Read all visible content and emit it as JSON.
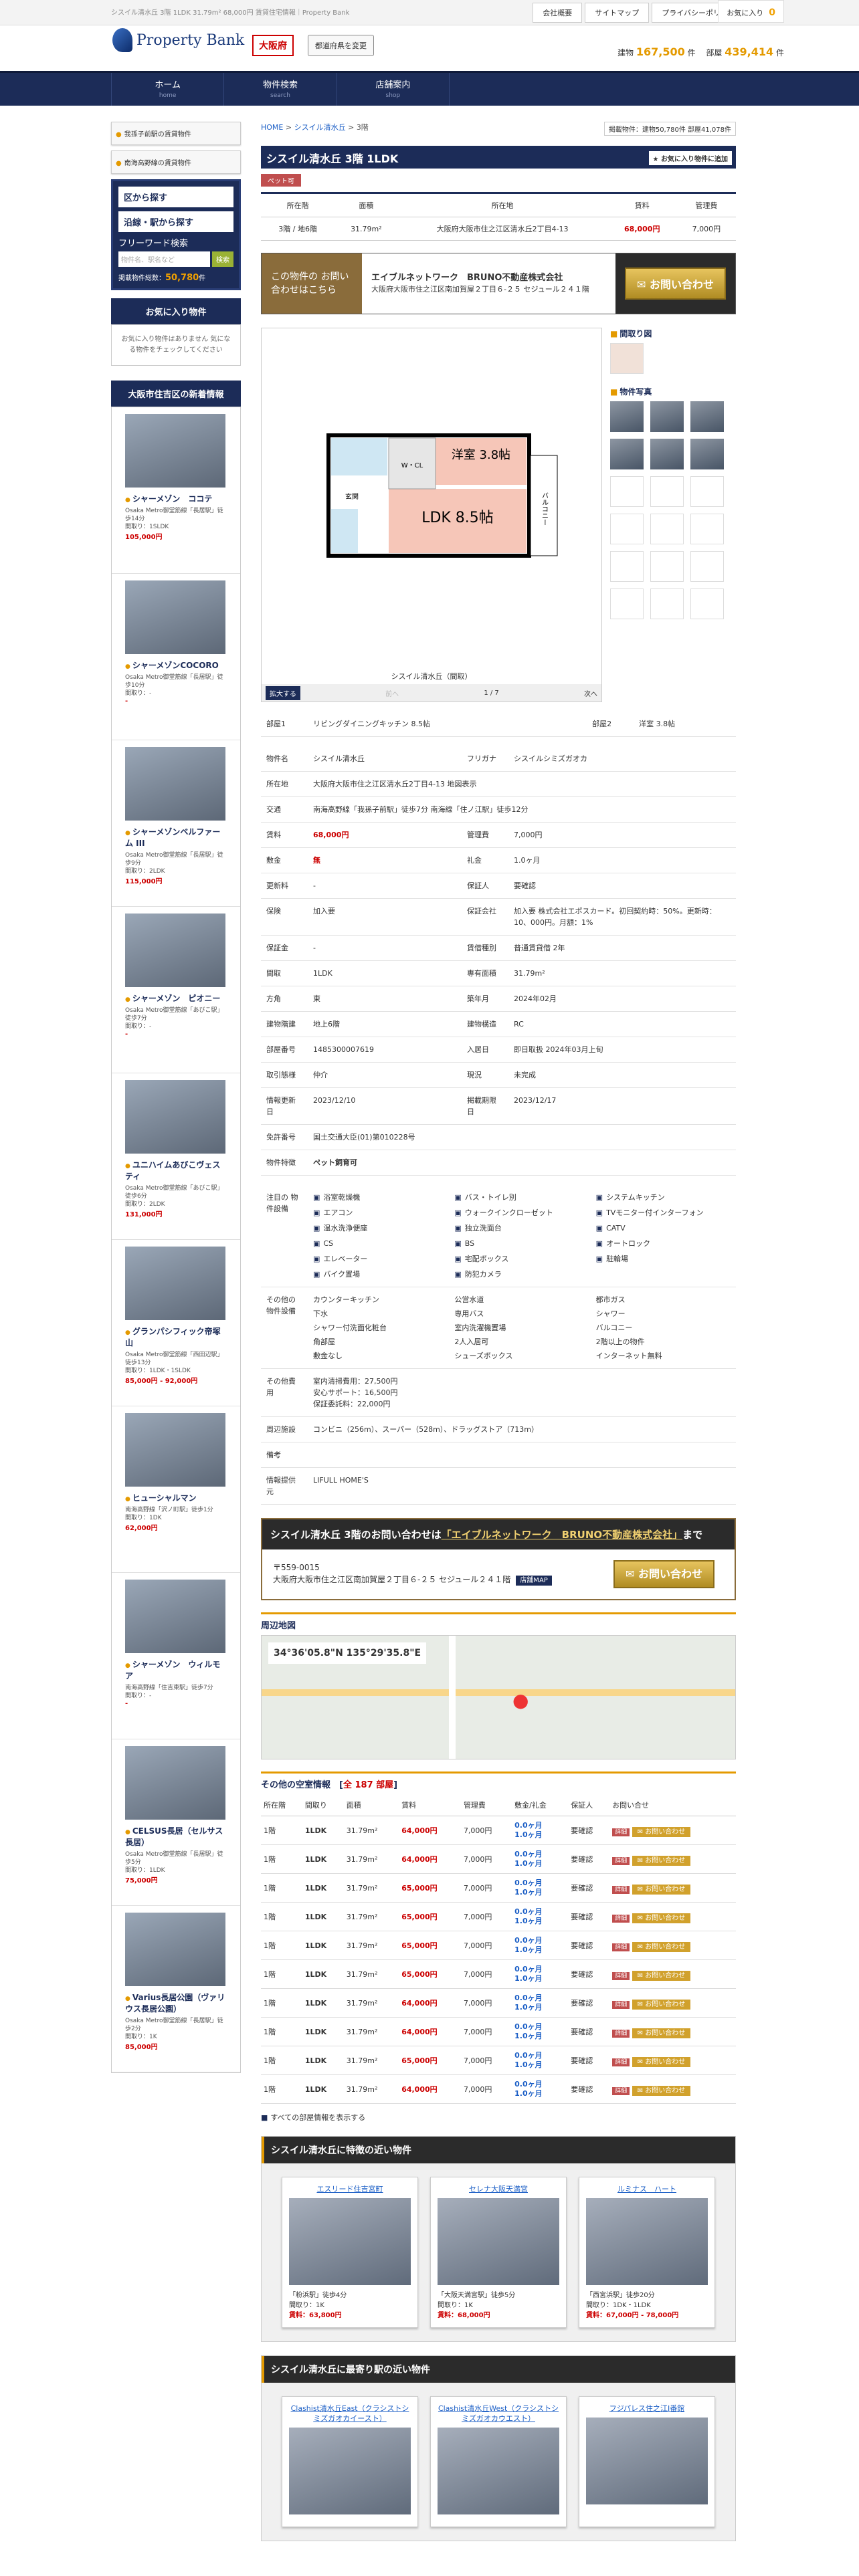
{
  "top": {
    "tagline": "シスイル清水丘 3階 1LDK 31.79m² 68,000円 賃貸住宅情報｜Property Bank",
    "links": [
      "会社概要",
      "サイトマップ",
      "プライバシーポリシー"
    ],
    "fav_label": "お気に入り",
    "fav_count": "0"
  },
  "header": {
    "logo": "Property Bank",
    "pref": "大阪府",
    "pref_change": "都道府県を変更",
    "count_label1": "建物",
    "count1": "167,500",
    "unit1": "件",
    "count_label2": "部屋",
    "count2": "439,414",
    "unit2": "件"
  },
  "nav": [
    {
      "label": "ホーム",
      "sub": "home"
    },
    {
      "label": "物件検索",
      "sub": "search"
    },
    {
      "label": "店舗案内",
      "sub": "shop"
    }
  ],
  "sidebar": {
    "btn1": "我孫子前駅の賃貸物件",
    "btn2": "南海高野線の賃貸物件",
    "search_area": "区から探す",
    "search_line": "沿線・駅から探す",
    "free_label": "フリーワード検索",
    "free_placeholder": "物件名、駅名など",
    "free_btn": "検索",
    "total_label": "掲載物件総数：",
    "total": "50,780",
    "total_unit": "件",
    "fav_head": "お気に入り物件",
    "fav_empty": "お気に入り物件はありません 気になる物件をチェックしてください",
    "new_head": "大阪市住吉区の新着情報",
    "new_items": [
      {
        "name": "シャーメゾン　ココテ",
        "l1": "Osaka Metro御堂筋線「長居駅」徒歩14分",
        "l2": "間取り：1SLDK",
        "price": "105,000円"
      },
      {
        "name": "シャーメゾンCOCORO",
        "l1": "Osaka Metro御堂筋線「長居駅」徒歩10分",
        "l2": "間取り：-",
        "price": "-"
      },
      {
        "name": "シャーメゾンベルファーム III",
        "l1": "Osaka Metro御堂筋線「長居駅」徒歩9分",
        "l2": "間取り：2LDK",
        "price": "115,000円"
      },
      {
        "name": "シャーメゾン　ピオニー",
        "l1": "Osaka Metro御堂筋線「あびこ駅」徒歩7分",
        "l2": "間取り：-",
        "price": "-"
      },
      {
        "name": "ユニハイムあびこヴェスティ",
        "l1": "Osaka Metro御堂筋線「あびこ駅」徒歩6分",
        "l2": "間取り：2LDK",
        "price": "131,000円"
      },
      {
        "name": "グランパシフィック帝塚山",
        "l1": "Osaka Metro御堂筋線「西田辺駅」徒歩13分",
        "l2": "間取り：1LDK・1SLDK",
        "price": "85,000円 - 92,000円"
      },
      {
        "name": "ヒューシャルマン",
        "l1": "南海高野線「沢ノ町駅」徒歩1分",
        "l2": "間取り：1DK",
        "price": "62,000円"
      },
      {
        "name": "シャーメゾン　ウィルモア",
        "l1": "南海高野線「住吉東駅」徒歩7分",
        "l2": "間取り：-",
        "price": "-"
      },
      {
        "name": "CELSUS長居（セルサス長居）",
        "l1": "Osaka Metro御堂筋線「長居駅」徒歩5分",
        "l2": "間取り：1LDK",
        "price": "75,000円"
      },
      {
        "name": "Varius長居公園（ヴァリウス長居公園）",
        "l1": "Osaka Metro御堂筋線「長居駅」徒歩2分",
        "l2": "間取り：1K",
        "price": "85,000円"
      }
    ]
  },
  "main": {
    "crumb": [
      "HOME",
      "シスイル清水丘",
      "3階"
    ],
    "crumb_counts": "掲載物件：建物50,780件 部屋41,078件",
    "title": "シスイル清水丘 3階 1LDK",
    "fav_btn": "お気に入り物件に追加",
    "pet": "ペット可",
    "summary": {
      "headers": [
        "所在階",
        "面積",
        "所在地",
        "賃料",
        "管理費"
      ],
      "row": [
        "3階 / 地6階",
        "31.79m²",
        "大阪府大阪市住之江区清水丘2丁目4-13",
        "68,000円",
        "7,000円"
      ]
    },
    "contact": {
      "lead": "この物件の お問い合わせはこちら",
      "company": "エイブルネットワーク　BRUNO不動産株式会社",
      "address": "大阪府大阪市住之江区南加賀屋２丁目６-２５ セジュール２４１階",
      "btn": "お問い合わせ"
    },
    "plan": {
      "room1": "洋室 3.8帖",
      "room2": "LDK 8.5帖",
      "wcl": "W・CL",
      "bal": "バルコニー",
      "ent": "玄関"
    },
    "caption": "シスイル清水丘（間取）",
    "zoom": "拡大する",
    "prev": "前へ",
    "pager": "1 / 7",
    "next": "次へ",
    "thumb_plan": "間取り図",
    "thumb_photo": "物件写真",
    "rooms": [
      [
        "部屋1",
        "リビングダイニングキッチン 8.5帖",
        "部屋2",
        "洋室 3.8帖"
      ]
    ],
    "details": [
      [
        "物件名",
        "シスイル清水丘",
        "フリガナ",
        "シスイルシミズガオカ"
      ],
      [
        "所在地",
        "大阪府大阪市住之江区清水丘2丁目4-13 地図表示",
        "",
        ""
      ],
      [
        "交通",
        "南海高野線「我孫子前駅」徒歩7分 南海線「住ノ江駅」徒歩12分",
        "",
        ""
      ],
      [
        "賃料",
        "68,000円",
        "管理費",
        "7,000円"
      ],
      [
        "敷金",
        "無",
        "礼金",
        "1.0ヶ月"
      ],
      [
        "更新料",
        "-",
        "保証人",
        "要確認"
      ],
      [
        "保険",
        "加入要",
        "保証会社",
        "加入要 株式会社エポスカード。初回契約時：50%。更新時：10、000円。月額：1%"
      ],
      [
        "保証金",
        "-",
        "賃借種別",
        "普通賃貸借 2年"
      ],
      [
        "間取",
        "1LDK",
        "専有面積",
        "31.79m²"
      ],
      [
        "方角",
        "東",
        "築年月",
        "2024年02月"
      ],
      [
        "建物階建",
        "地上6階",
        "建物構造",
        "RC"
      ],
      [
        "部屋番号",
        "1485300007619",
        "入居日",
        "即日取扱 2024年03月上旬"
      ],
      [
        "取引態様",
        "仲介",
        "現況",
        "未完成"
      ],
      [
        "情報更新日",
        "2023/12/10",
        "掲載期限日",
        "2023/12/17"
      ],
      [
        "免許番号",
        "国土交通大臣(01)第010228号",
        "",
        ""
      ],
      [
        "物件特徴",
        "ペット飼育可",
        "",
        ""
      ]
    ],
    "equip_label": "注目の 物件設備",
    "equip": [
      "浴室乾燥機",
      "バス・トイレ別",
      "システムキッチン",
      "エアコン",
      "ウォークインクローゼット",
      "TVモニター付インターフォン",
      "温水洗浄便座",
      "独立洗面台",
      "CATV",
      "CS",
      "BS",
      "オートロック",
      "エレベーター",
      "宅配ボックス",
      "駐輪場",
      "バイク置場",
      "防犯カメラ",
      ""
    ],
    "other_equip_label": "その他の 物件設備",
    "other_equip": [
      "カウンターキッチン",
      "公営水道",
      "都市ガス",
      "下水",
      "専用バス",
      "シャワー",
      "シャワー付洗面化粧台",
      "室内洗濯機置場",
      "バルコニー",
      "角部屋",
      "2人入居可",
      "2階以上の物件",
      "敷金なし",
      "シューズボックス",
      "インターネット無料"
    ],
    "fees_label": "その他費用",
    "fees": [
      "室内清掃費用：27,500円",
      "安心サポート：16,500円",
      "保証委託料：22,000円"
    ],
    "env_label": "周辺施設",
    "env": "コンビニ（256m）、スーパー（528m）、ドラッグストア（713m）",
    "note_label": "備考",
    "note": "",
    "src_label": "情報提供元",
    "src": "LIFULL HOME'S",
    "inq_head_pre": "シスイル清水丘 3階のお問い合わせは",
    "inq_company": "「エイブルネットワーク　BRUNO不動産株式会社」",
    "inq_head_post": "まで",
    "inq_zip": "〒559-0015",
    "inq_addr": "大阪府大阪市住之江区南加賀屋２丁目６-２５ セジュール２４１階",
    "inq_map": "店舗MAP",
    "inq_btn": "お問い合わせ",
    "map_title": "周辺地図",
    "map_coord": "34°36'05.8\"N 135°29'35.8\"E",
    "others_title": "その他の空室情報",
    "others_count": "全 187 部屋",
    "others_headers": [
      "所在階",
      "間取り",
      "面積",
      "賃料",
      "管理費",
      "敷金/礼金",
      "保証人",
      "お問い合せ"
    ],
    "others_rows": [
      [
        "1階",
        "1LDK",
        "31.79m²",
        "64,000円",
        "7,000円",
        "0.0ヶ月",
        "1.0ヶ月",
        "要確認"
      ],
      [
        "1階",
        "1LDK",
        "31.79m²",
        "64,000円",
        "7,000円",
        "0.0ヶ月",
        "1.0ヶ月",
        "要確認"
      ],
      [
        "1階",
        "1LDK",
        "31.79m²",
        "65,000円",
        "7,000円",
        "0.0ヶ月",
        "1.0ヶ月",
        "要確認"
      ],
      [
        "1階",
        "1LDK",
        "31.79m²",
        "65,000円",
        "7,000円",
        "0.0ヶ月",
        "1.0ヶ月",
        "要確認"
      ],
      [
        "1階",
        "1LDK",
        "31.79m²",
        "65,000円",
        "7,000円",
        "0.0ヶ月",
        "1.0ヶ月",
        "要確認"
      ],
      [
        "1階",
        "1LDK",
        "31.79m²",
        "65,000円",
        "7,000円",
        "0.0ヶ月",
        "1.0ヶ月",
        "要確認"
      ],
      [
        "1階",
        "1LDK",
        "31.79m²",
        "64,000円",
        "7,000円",
        "0.0ヶ月",
        "1.0ヶ月",
        "要確認"
      ],
      [
        "1階",
        "1LDK",
        "31.79m²",
        "64,000円",
        "7,000円",
        "0.0ヶ月",
        "1.0ヶ月",
        "要確認"
      ],
      [
        "1階",
        "1LDK",
        "31.79m²",
        "65,000円",
        "7,000円",
        "0.0ヶ月",
        "1.0ヶ月",
        "要確認"
      ],
      [
        "1階",
        "1LDK",
        "31.79m²",
        "64,000円",
        "7,000円",
        "0.0ヶ月",
        "1.0ヶ月",
        "要確認"
      ]
    ],
    "detail_tag": "詳細",
    "inq_tag": "お問い合わせ",
    "all_rooms": "すべての部屋情報を表示する",
    "near1_head": "シスイル清水丘に特徴の近い物件",
    "near1": [
      {
        "name": "エスリード住吉宮町",
        "l1": "「粉浜駅」徒歩4分",
        "l2": "間取り：1K",
        "l3": "賃料：63,800円"
      },
      {
        "name": "セレナ大阪天満宮",
        "l1": "「大阪天満宮駅」徒歩5分",
        "l2": "間取り：1K",
        "l3": "賃料：68,000円"
      },
      {
        "name": "ルミナス　ハート",
        "l1": "「西宮浜駅」徒歩20分",
        "l2": "間取り：1DK・1LDK",
        "l3": "賃料：67,000円 - 78,000円"
      }
    ],
    "near2_head": "シスイル清水丘に最寄り駅の近い物件",
    "near2": [
      {
        "name": "Clashist清水丘East（クラシストシミズガオカイースト）"
      },
      {
        "name": "Clashist清水丘West（クラシストシミズガオカウエスト）"
      },
      {
        "name": "フジパレス住之江Ⅰ番館"
      }
    ]
  }
}
